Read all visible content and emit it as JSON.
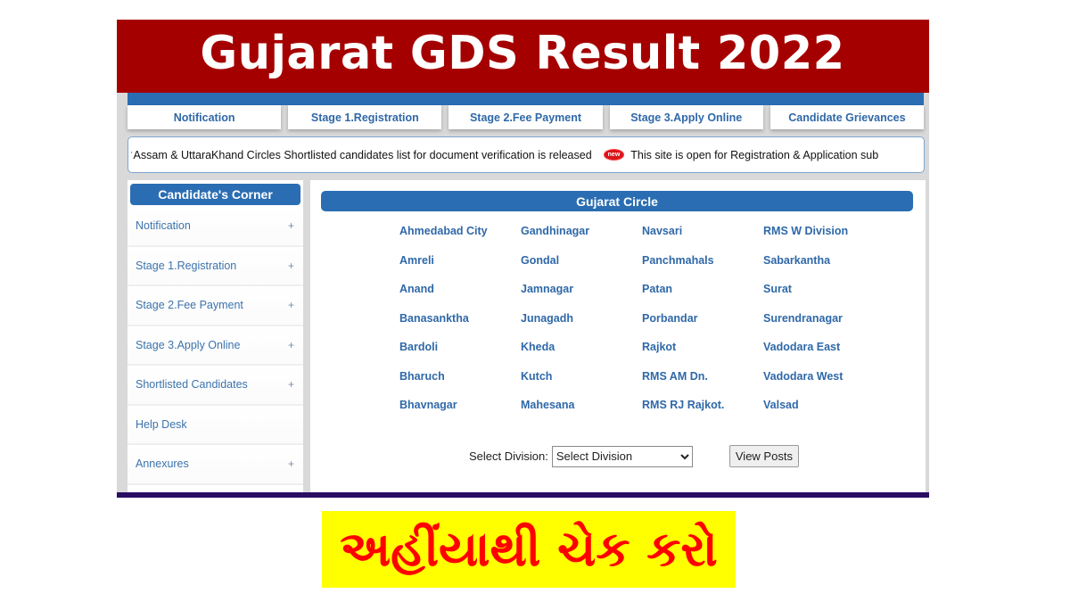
{
  "header": {
    "title": "Gujarat GDS Result 2022"
  },
  "tabs": [
    {
      "label": "Notification"
    },
    {
      "label": "Stage 1.Registration"
    },
    {
      "label": "Stage 2.Fee Payment"
    },
    {
      "label": "Stage 3.Apply Online"
    },
    {
      "label": "Candidate Grievances"
    }
  ],
  "ticker": {
    "message_1": "Assam & UttaraKhand Circles Shortlisted candidates list for document verification is released",
    "badge": "new",
    "message_2": "This site is open for Registration & Application sub"
  },
  "sidebar": {
    "title": "Candidate's Corner",
    "items": [
      {
        "label": "Notification",
        "expand": "+"
      },
      {
        "label": "Stage 1.Registration",
        "expand": "+"
      },
      {
        "label": "Stage 2.Fee Payment",
        "expand": "+"
      },
      {
        "label": "Stage 3.Apply Online",
        "expand": "+"
      },
      {
        "label": "Shortlisted Candidates",
        "expand": "+"
      },
      {
        "label": "Help Desk",
        "expand": ""
      },
      {
        "label": "Annexures",
        "expand": "+"
      }
    ]
  },
  "main": {
    "title": "Gujarat Circle",
    "divisions": [
      "Ahmedabad City",
      "Gandhinagar",
      "Navsari",
      "RMS W Division",
      "Amreli",
      "Gondal",
      "Panchmahals",
      "Sabarkantha",
      "Anand",
      "Jamnagar",
      "Patan",
      "Surat",
      "Banasanktha",
      "Junagadh",
      "Porbandar",
      "Surendranagar",
      "Bardoli",
      "Kheda",
      "Rajkot",
      "Vadodara East",
      "Bharuch",
      "Kutch",
      "RMS AM Dn.",
      "Vadodara West",
      "Bhavnagar",
      "Mahesana",
      "RMS RJ Rajkot.",
      "Valsad"
    ],
    "select_label": "Select Division:",
    "select_value": "Select Division",
    "view_button": "View Posts"
  },
  "cta": {
    "label": "અહીંયાથી ચેક કરો"
  },
  "colors": {
    "title_bg": "#a50000",
    "accent_blue": "#2a6db3",
    "link_blue": "#2f68a8",
    "cta_bg": "#ffff00",
    "cta_text": "#ff0000",
    "bottom_bar": "#2b0d63"
  }
}
